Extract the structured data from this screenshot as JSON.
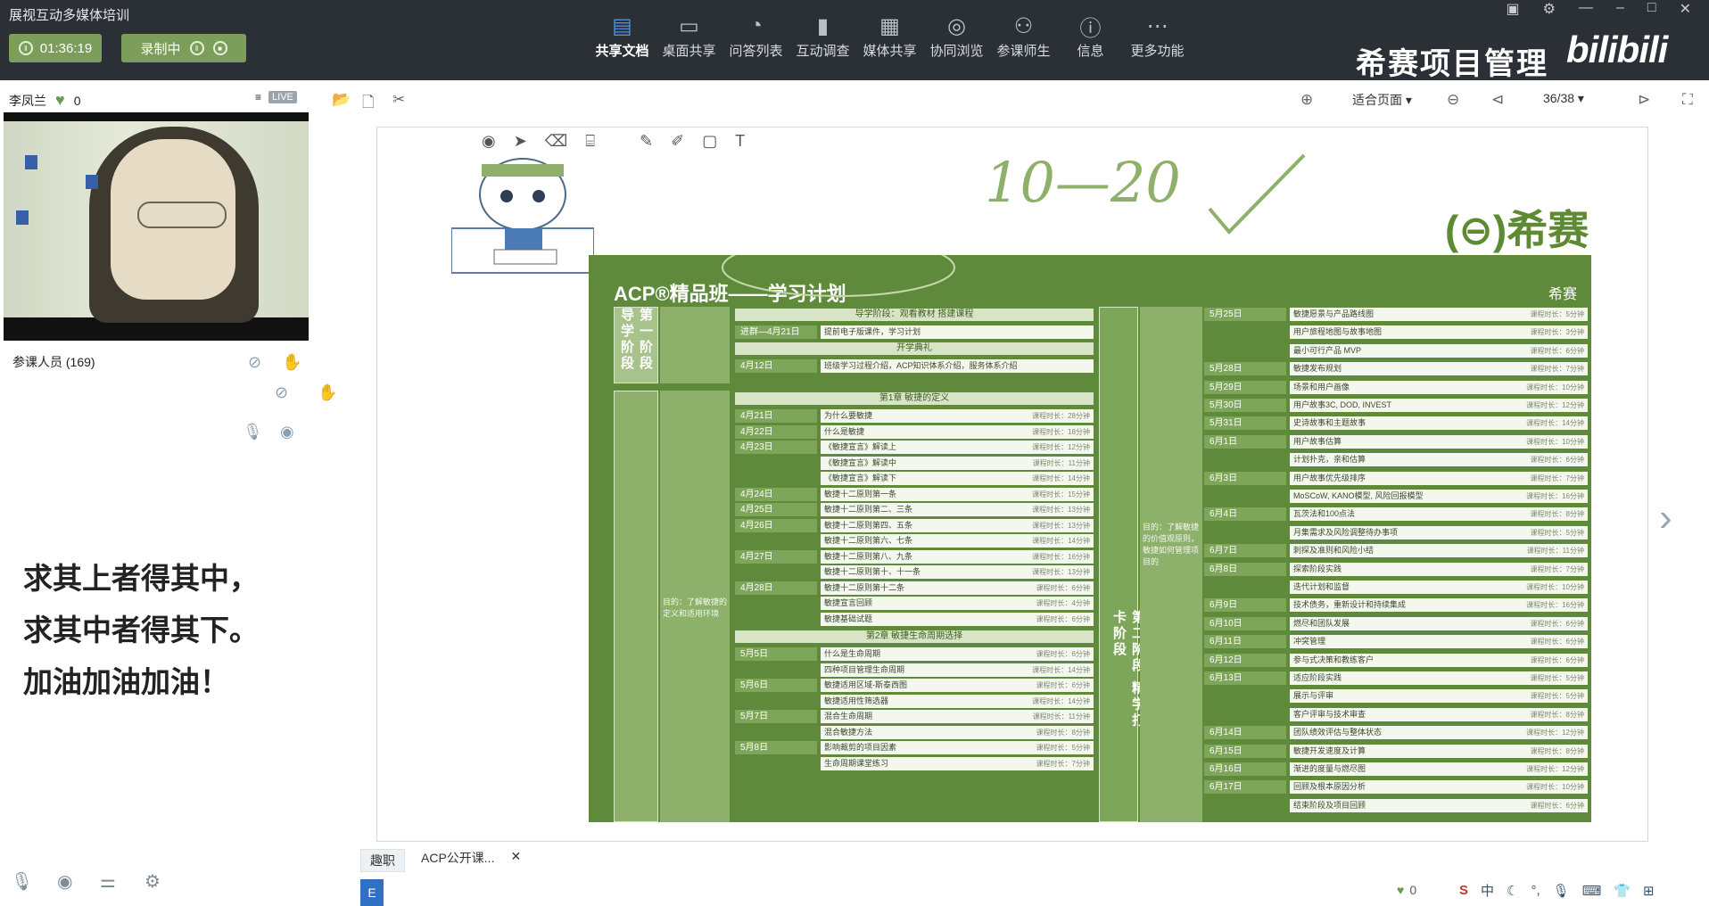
{
  "app": {
    "title": "展视互动多媒体培训"
  },
  "controls": {
    "timer": "01:36:19",
    "recording": "录制中"
  },
  "nav": [
    {
      "label": "共享文档",
      "icon": "document-icon",
      "active": true
    },
    {
      "label": "桌面共享",
      "icon": "desktop-icon",
      "active": false
    },
    {
      "label": "问答列表",
      "icon": "qa-icon",
      "active": false
    },
    {
      "label": "互动调查",
      "icon": "chart-icon",
      "active": false
    },
    {
      "label": "媒体共享",
      "icon": "film-icon",
      "active": false
    },
    {
      "label": "协同浏览",
      "icon": "compass-icon",
      "active": false
    },
    {
      "label": "参课师生",
      "icon": "people-icon",
      "active": false
    },
    {
      "label": "信息",
      "icon": "info-icon",
      "active": false
    },
    {
      "label": "更多功能",
      "icon": "more-icon",
      "active": false
    }
  ],
  "branding": {
    "name": "希赛项目管理",
    "site": "bilibili"
  },
  "presenter": {
    "name": "李凤兰",
    "likes": "0",
    "live": "LIVE"
  },
  "attendees": "参课人员 (169)",
  "motto": [
    "求其上者得其中，",
    "求其中者得其下。",
    "加油加油加油！"
  ],
  "doc_toolbar": {
    "zoom": "适合页面",
    "page": "36/38"
  },
  "slide": {
    "handwriting": "10—20",
    "logo": "希赛",
    "plan_title": "ACP®精品班——学习计划",
    "plan_logo": "希赛",
    "stage1": "第一阶段 导学阶段",
    "stage2": "第二阶段 精学打卡阶段",
    "stage1_header": "导学阶段：观看教材 搭建课程",
    "stage1_row1_date": "进群—4月21日",
    "stage1_row1_task": "提前电子版课件，学习计划",
    "stage1_sub": "开学典礼",
    "stage1_row2_date": "4月12日",
    "stage1_row2_task": "班级学习过程介绍，ACP知识体系介绍，服务体系介绍",
    "ch1_header": "第1章 敏捷的定义",
    "ch2_header": "第2章 敏捷生命周期选择",
    "goal_left": "目的：了解敏捷的定义和适用环境",
    "goal_right": "目的：了解敏捷的价值观原则，敏捷如何管理项目的",
    "left_rows": [
      {
        "date": "4月21日",
        "task": "为什么要敏捷",
        "dur": "课程时长：28分钟"
      },
      {
        "date": "4月22日",
        "task": "什么是敏捷",
        "dur": "课程时长：18分钟"
      },
      {
        "date": "4月23日",
        "task": "《敏捷宣言》解读上",
        "dur": "课程时长：12分钟"
      },
      {
        "date": "",
        "task": "《敏捷宣言》解读中",
        "dur": "课程时长：11分钟"
      },
      {
        "date": "",
        "task": "《敏捷宣言》解读下",
        "dur": "课程时长：14分钟"
      },
      {
        "date": "4月24日",
        "task": "敏捷十二原则第一条",
        "dur": "课程时长：15分钟"
      },
      {
        "date": "4月25日",
        "task": "敏捷十二原则第二、三条",
        "dur": "课程时长：13分钟"
      },
      {
        "date": "4月26日",
        "task": "敏捷十二原则第四、五条",
        "dur": "课程时长：13分钟"
      },
      {
        "date": "",
        "task": "敏捷十二原则第六、七条",
        "dur": "课程时长：14分钟"
      },
      {
        "date": "4月27日",
        "task": "敏捷十二原则第八、九条",
        "dur": "课程时长：16分钟"
      },
      {
        "date": "",
        "task": "敏捷十二原则第十、十一条",
        "dur": "课程时长：13分钟"
      },
      {
        "date": "4月28日",
        "task": "敏捷十二原则第十二条",
        "dur": "课程时长：6分钟"
      },
      {
        "date": "",
        "task": "敏捷宣言回顾",
        "dur": "课程时长：4分钟"
      },
      {
        "date": "",
        "task": "敏捷基础试题",
        "dur": "课程时长：6分钟"
      }
    ],
    "left_rows2": [
      {
        "date": "5月5日",
        "task": "什么是生命周期",
        "dur": "课程时长：6分钟"
      },
      {
        "date": "",
        "task": "四种项目管理生命周期",
        "dur": "课程时长：14分钟"
      },
      {
        "date": "5月6日",
        "task": "敏捷适用区域-斯泰西图",
        "dur": "课程时长：6分钟"
      },
      {
        "date": "",
        "task": "敏捷适用性筛选器",
        "dur": "课程时长：14分钟"
      },
      {
        "date": "5月7日",
        "task": "混合生命周期",
        "dur": "课程时长：11分钟"
      },
      {
        "date": "",
        "task": "混合敏捷方法",
        "dur": "课程时长：8分钟"
      },
      {
        "date": "5月8日",
        "task": "影响裁剪的项目因素",
        "dur": "课程时长：5分钟"
      },
      {
        "date": "",
        "task": "生命周期课堂练习",
        "dur": "课程时长：7分钟"
      }
    ],
    "right_rows": [
      {
        "date": "5月25日",
        "task": "敏捷愿景与产品路线图",
        "dur": "课程时长：5分钟"
      },
      {
        "date": "",
        "task": "用户旅程地图与故事地图",
        "dur": "课程时长：3分钟"
      },
      {
        "date": "",
        "task": "最小可行产品 MVP",
        "dur": "课程时长：6分钟"
      },
      {
        "date": "5月28日",
        "task": "敏捷发布规划",
        "dur": "课程时长：7分钟"
      },
      {
        "date": "5月29日",
        "task": "场景和用户画像",
        "dur": "课程时长：10分钟"
      },
      {
        "date": "5月30日",
        "task": "用户故事3C, DOD, INVEST",
        "dur": "课程时长：12分钟"
      },
      {
        "date": "5月31日",
        "task": "史诗故事和主题故事",
        "dur": "课程时长：14分钟"
      },
      {
        "date": "6月1日",
        "task": "用户故事估算",
        "dur": "课程时长：10分钟"
      },
      {
        "date": "",
        "task": "计划扑克，亲和估算",
        "dur": "课程时长：6分钟"
      },
      {
        "date": "6月3日",
        "task": "用户故事优先级排序",
        "dur": "课程时长：7分钟"
      },
      {
        "date": "",
        "task": "MoSCoW, KANO模型, 风险回报模型",
        "dur": "课程时长：16分钟"
      },
      {
        "date": "6月4日",
        "task": "瓦茨法和100点法",
        "dur": "课程时长：8分钟"
      },
      {
        "date": "",
        "task": "月集需求及风险调整待办事项",
        "dur": "课程时长：5分钟"
      },
      {
        "date": "6月7日",
        "task": "刺探及准则和风险小结",
        "dur": "课程时长：11分钟"
      },
      {
        "date": "6月8日",
        "task": "探索阶段实践",
        "dur": "课程时长：7分钟"
      },
      {
        "date": "",
        "task": "迭代计划和监督",
        "dur": "课程时长：10分钟"
      },
      {
        "date": "6月9日",
        "task": "技术债务，重新设计和持续集成",
        "dur": "课程时长：16分钟"
      },
      {
        "date": "6月10日",
        "task": "燃尽和团队发展",
        "dur": "课程时长：6分钟"
      },
      {
        "date": "6月11日",
        "task": "冲突管理",
        "dur": "课程时长：6分钟"
      },
      {
        "date": "6月12日",
        "task": "参与式决策和教练客户",
        "dur": "课程时长：6分钟"
      },
      {
        "date": "6月13日",
        "task": "适应阶段实践",
        "dur": "课程时长：5分钟"
      },
      {
        "date": "",
        "task": "展示与评审",
        "dur": "课程时长：5分钟"
      },
      {
        "date": "",
        "task": "客户评审与技术审查",
        "dur": "课程时长：8分钟"
      },
      {
        "date": "6月14日",
        "task": "团队绩效评估与整体状态",
        "dur": "课程时长：12分钟"
      },
      {
        "date": "6月15日",
        "task": "敏捷开发速度及计算",
        "dur": "课程时长：8分钟"
      },
      {
        "date": "6月16日",
        "task": "渐进的度量与燃尽图",
        "dur": "课程时长：12分钟"
      },
      {
        "date": "6月17日",
        "task": "回顾及根本原因分析",
        "dur": "课程时长：10分钟"
      },
      {
        "date": "",
        "task": "结束阶段及项目回顾",
        "dur": "课程时长：6分钟"
      }
    ]
  },
  "bottom": {
    "tab1": "趣职",
    "tab2": "ACP公开课...",
    "likes": "0",
    "tray_ime": "中"
  }
}
